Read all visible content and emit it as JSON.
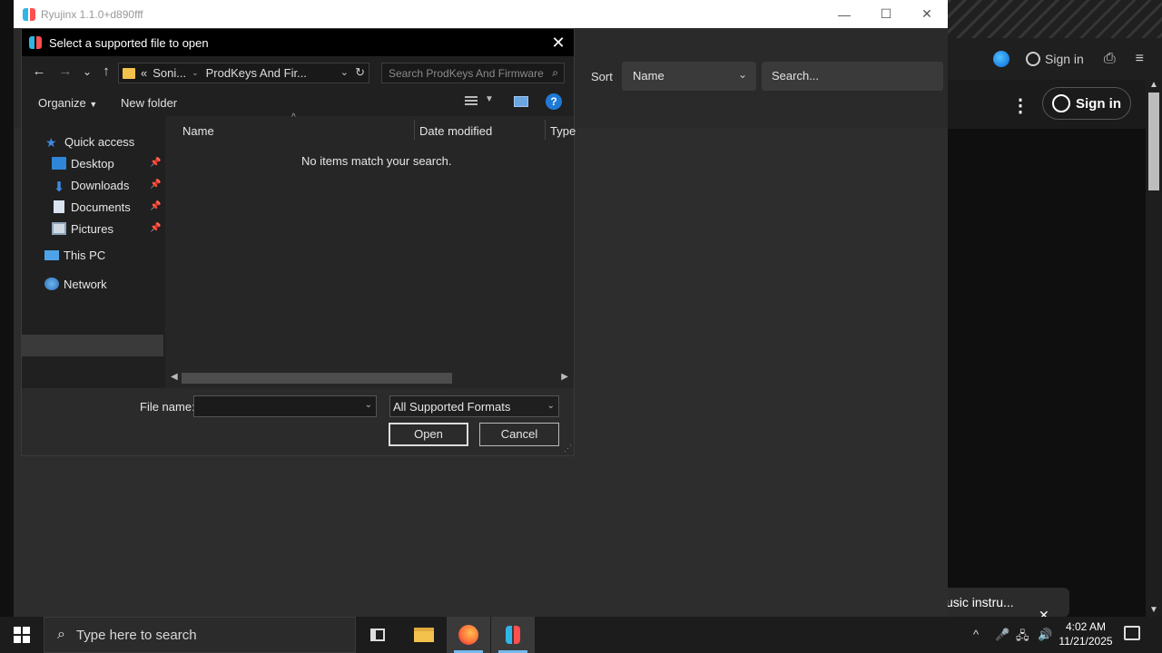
{
  "main_window": {
    "title": "Ryujinx 1.1.0+d890fff",
    "controls": {
      "minimize": "—",
      "maximize": "☐",
      "close": "✕"
    },
    "toolbar": {
      "sort_label": "Sort",
      "sort_value": "Name",
      "search_placeholder": "Search..."
    }
  },
  "dialog": {
    "title": "Select a supported file to open",
    "close_glyph": "✕",
    "nav": {
      "back": "←",
      "forward": "→",
      "recent": "⌄",
      "up": "↑"
    },
    "address": {
      "overflow": "«",
      "segments": [
        "Soni...",
        "ProdKeys And Fir..."
      ]
    },
    "search_placeholder": "Search ProdKeys And Firmware",
    "commands": {
      "organize": "Organize",
      "new_folder": "New folder",
      "help": "?"
    },
    "navpane": {
      "quick_access": "Quick access",
      "pinned": [
        {
          "label": "Desktop"
        },
        {
          "label": "Downloads"
        },
        {
          "label": "Documents"
        },
        {
          "label": "Pictures"
        }
      ],
      "this_pc": "This PC",
      "network": "Network"
    },
    "columns": [
      "Name",
      "Date modified",
      "Type"
    ],
    "empty_message": "No items match your search.",
    "file_name_label": "File name:",
    "file_name_value": "",
    "filter_value": "All Supported Formats",
    "open_label": "Open",
    "cancel_label": "Cancel"
  },
  "browser": {
    "sign_in_small": "Sign in",
    "sign_in_button": "Sign in",
    "mini_player_text": "usic instru..."
  },
  "taskbar": {
    "search_placeholder": "Type here to search",
    "time": "4:02 AM",
    "date": "11/21/2025"
  }
}
